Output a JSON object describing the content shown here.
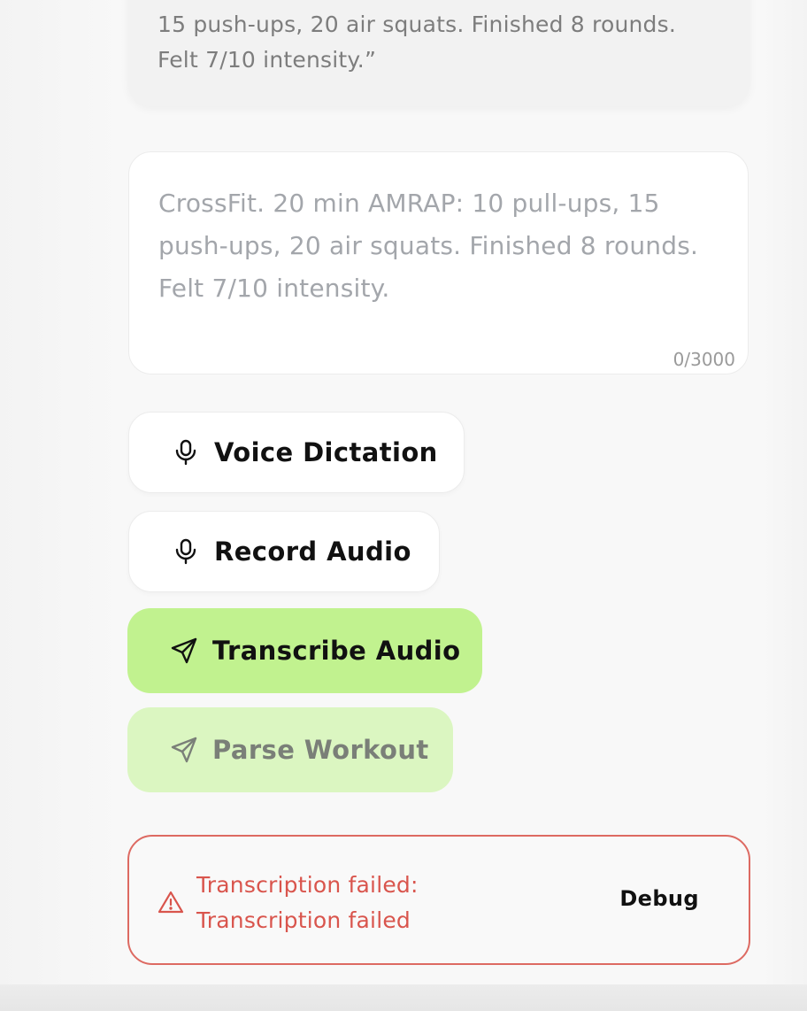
{
  "example": {
    "text": "15 push-ups, 20 air squats. Finished 8 rounds. Felt 7/10 intensity.”"
  },
  "workout_input": {
    "value": "",
    "placeholder": "CrossFit. 20 min AMRAP: 10 pull-ups, 15 push-ups, 20 air squats. Finished 8 rounds. Felt 7/10 intensity.",
    "counter": "0/3000"
  },
  "actions": {
    "voice_dictation": {
      "label": "Voice Dictation",
      "icon": "microphone-icon"
    },
    "record_audio": {
      "label": "Record Audio",
      "icon": "microphone-icon"
    },
    "transcribe_audio": {
      "label": "Transcribe Audio",
      "icon": "send-icon"
    },
    "parse_workout": {
      "label": "Parse Workout",
      "icon": "send-icon"
    }
  },
  "error": {
    "message": "Transcription failed: Transcription failed",
    "debug_label": "Debug",
    "icon": "warning-triangle-icon"
  },
  "colors": {
    "primary_green": "#c1f28f",
    "disabled_green": "#dbf6c1",
    "error_red": "#dd6a62"
  }
}
